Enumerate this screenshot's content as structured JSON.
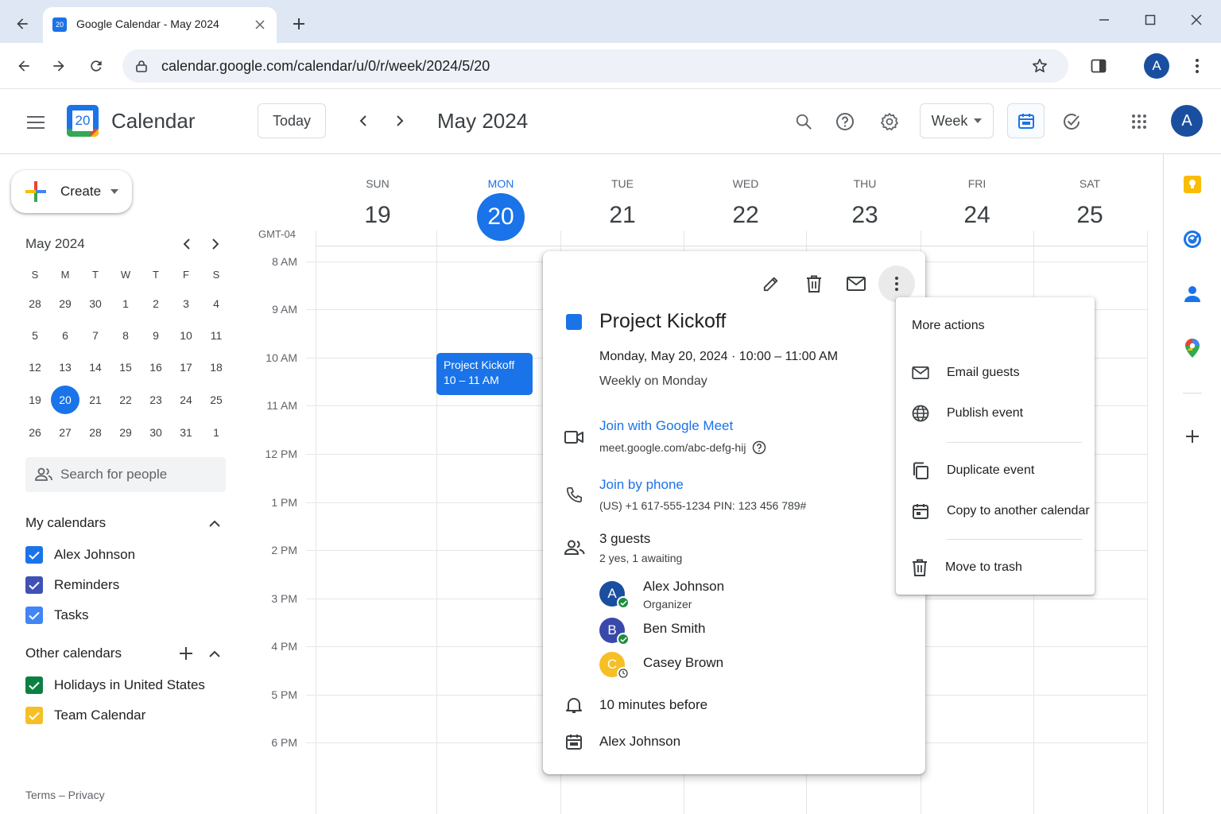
{
  "browser": {
    "tab_title": "Google Calendar - May 2024",
    "tab_favicon_text": "20",
    "url": "calendar.google.com/calendar/u/0/r/week/2024/5/20",
    "profile_initial": "A"
  },
  "header": {
    "app_name": "Calendar",
    "logo_text": "20",
    "today_label": "Today",
    "month_title": "May 2024",
    "view_label": "Week",
    "profile_initial": "A"
  },
  "sidebar": {
    "create_label": "Create",
    "mini_calendar": {
      "title": "May 2024",
      "weekdays": [
        "S",
        "M",
        "T",
        "W",
        "T",
        "F",
        "S"
      ],
      "weeks": [
        [
          "28",
          "29",
          "30",
          "1",
          "2",
          "3",
          "4"
        ],
        [
          "5",
          "6",
          "7",
          "8",
          "9",
          "10",
          "11"
        ],
        [
          "12",
          "13",
          "14",
          "15",
          "16",
          "17",
          "18"
        ],
        [
          "19",
          "20",
          "21",
          "22",
          "23",
          "24",
          "25"
        ],
        [
          "26",
          "27",
          "28",
          "29",
          "30",
          "31",
          "1"
        ]
      ],
      "selected": "20"
    },
    "search_people_placeholder": "Search for people",
    "my_calendars_title": "My calendars",
    "my_calendars": [
      {
        "name": "Alex Johnson",
        "color": "#1a73e8"
      },
      {
        "name": "Reminders",
        "color": "#3f51b5"
      },
      {
        "name": "Tasks",
        "color": "#4285f4"
      }
    ],
    "other_calendars_title": "Other calendars",
    "other_calendars": [
      {
        "name": "Holidays in United States",
        "color": "#0b8043"
      },
      {
        "name": "Team Calendar",
        "color": "#f6bf26"
      }
    ],
    "footer": "Terms – Privacy"
  },
  "grid": {
    "timezone": "GMT-04",
    "days": [
      {
        "name": "SUN",
        "num": "19"
      },
      {
        "name": "MON",
        "num": "20"
      },
      {
        "name": "TUE",
        "num": "21"
      },
      {
        "name": "WED",
        "num": "22"
      },
      {
        "name": "THU",
        "num": "23"
      },
      {
        "name": "FRI",
        "num": "24"
      },
      {
        "name": "SAT",
        "num": "25"
      }
    ],
    "hours": [
      "8 AM",
      "9 AM",
      "10 AM",
      "11 AM",
      "12 PM",
      "1 PM",
      "2 PM",
      "3 PM",
      "4 PM",
      "5 PM",
      "6 PM"
    ],
    "event": {
      "title": "Project Kickoff",
      "time": "10 – 11 AM",
      "color": "#1a73e8"
    }
  },
  "popup": {
    "title": "Project Kickoff",
    "color": "#1a73e8",
    "datetime": "Monday, May 20, 2024 · 10:00 – 11:00 AM",
    "recurrence": "Weekly on Monday",
    "meet_label": "Join with Google Meet",
    "meet_url": "meet.google.com/abc-defg-hij",
    "phone_label": "Join by phone",
    "phone_detail": "(US) +1 617-555-1234 PIN: 123 456 789#",
    "guests_count": "3 guests",
    "guests_summary": "2 yes, 1 awaiting",
    "guests": [
      {
        "initial": "A",
        "name": "Alex Johnson",
        "role": "Organizer",
        "color": "#1a4fa0",
        "status": "yes"
      },
      {
        "initial": "B",
        "name": "Ben Smith",
        "role": "",
        "color": "#3949ab",
        "status": "yes"
      },
      {
        "initial": "C",
        "name": "Casey Brown",
        "role": "",
        "color": "#f6bf26",
        "status": "awaiting"
      }
    ],
    "reminder": "10 minutes before",
    "calendar_owner": "Alex Johnson"
  },
  "menu": {
    "title": "More actions",
    "items": [
      {
        "label": "Email guests",
        "icon": "mail-icon"
      },
      {
        "label": "Publish event",
        "icon": "globe-icon"
      },
      {
        "label": "Duplicate event",
        "icon": "duplicate-icon"
      },
      {
        "label": "Copy to another calendar",
        "icon": "calendar-copy-icon"
      },
      {
        "label": "Move to trash",
        "icon": "trash-icon"
      }
    ]
  }
}
